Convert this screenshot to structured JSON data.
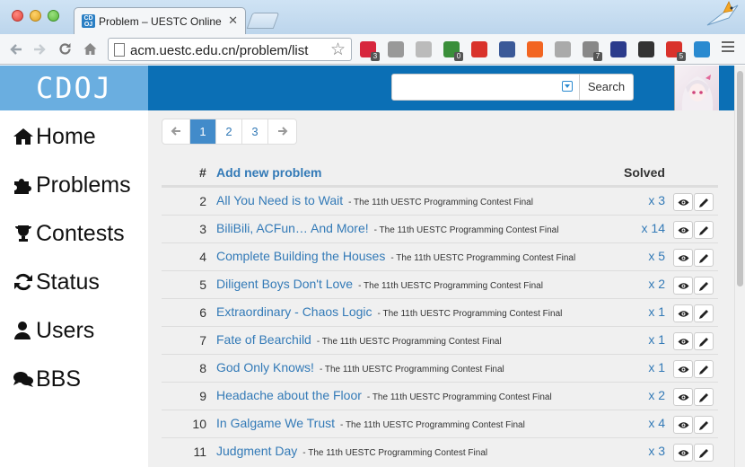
{
  "browser": {
    "tab_title": "Problem – UESTC Online Ju",
    "url": "acm.uestc.edu.cn/problem/list",
    "extensions": [
      {
        "name": "lastpass-icon",
        "color": "#d7263d",
        "badge": "3"
      },
      {
        "name": "pocket-icon",
        "color": "#999999",
        "badge": ""
      },
      {
        "name": "sync-icon",
        "color": "#bbbbbb",
        "badge": ""
      },
      {
        "name": "html-validator-icon",
        "color": "#3a8f3a",
        "badge": "0"
      },
      {
        "name": "adblock-icon",
        "color": "#d9322b",
        "badge": ""
      },
      {
        "name": "facebook-icon",
        "color": "#3b5998",
        "badge": ""
      },
      {
        "name": "rss-icon",
        "color": "#f26522",
        "badge": ""
      },
      {
        "name": "bell-icon",
        "color": "#aaaaaa",
        "badge": ""
      },
      {
        "name": "screen-capture-icon",
        "color": "#888888",
        "badge": "7"
      },
      {
        "name": "mountain-icon",
        "color": "#2b3b8c",
        "badge": ""
      },
      {
        "name": "color-picker-icon",
        "color": "#333333",
        "badge": ""
      },
      {
        "name": "puzzle-ext-icon",
        "color": "#d9322b",
        "badge": "5"
      },
      {
        "name": "camera-icon",
        "color": "#2a8ad0",
        "badge": ""
      }
    ]
  },
  "header": {
    "brand": "CDOJ",
    "search_placeholder": "",
    "search_button": "Search",
    "brand_color": "#6aaee0",
    "bar_color": "#0b6fb5"
  },
  "sidebar": {
    "items": [
      {
        "label": "Home",
        "icon": "home-icon"
      },
      {
        "label": "Problems",
        "icon": "puzzle-icon"
      },
      {
        "label": "Contests",
        "icon": "trophy-icon"
      },
      {
        "label": "Status",
        "icon": "refresh-icon"
      },
      {
        "label": "Users",
        "icon": "user-icon"
      },
      {
        "label": "BBS",
        "icon": "comments-icon"
      }
    ]
  },
  "pagination": {
    "prev": "←",
    "next": "→",
    "pages": [
      "1",
      "2",
      "3"
    ],
    "active": "1"
  },
  "table": {
    "headers": {
      "id": "#",
      "title": "Add new problem",
      "solved": "Solved"
    },
    "rows": [
      {
        "id": "2",
        "title": "All You Need is to Wait",
        "source": "- The 11th UESTC Programming Contest Final",
        "solved": "x 3"
      },
      {
        "id": "3",
        "title": "BiliBili, ACFun… And More!",
        "source": "- The 11th UESTC Programming Contest Final",
        "solved": "x 14"
      },
      {
        "id": "4",
        "title": "Complete Building the Houses",
        "source": "- The 11th UESTC Programming Contest Final",
        "solved": "x 5"
      },
      {
        "id": "5",
        "title": "Diligent Boys Don't Love",
        "source": "- The 11th UESTC Programming Contest Final",
        "solved": "x 2"
      },
      {
        "id": "6",
        "title": "Extraordinary - Chaos Logic",
        "source": "- The 11th UESTC Programming Contest Final",
        "solved": "x 1"
      },
      {
        "id": "7",
        "title": "Fate of Bearchild",
        "source": "- The 11th UESTC Programming Contest Final",
        "solved": "x 1"
      },
      {
        "id": "8",
        "title": "God Only Knows!",
        "source": "- The 11th UESTC Programming Contest Final",
        "solved": "x 1"
      },
      {
        "id": "9",
        "title": "Headache about the Floor",
        "source": "- The 11th UESTC Programming Contest Final",
        "solved": "x 2"
      },
      {
        "id": "10",
        "title": "In Galgame We Trust",
        "source": "- The 11th UESTC Programming Contest Final",
        "solved": "x 4"
      },
      {
        "id": "11",
        "title": "Judgment Day",
        "source": "- The 11th UESTC Programming Contest Final",
        "solved": "x 3"
      }
    ]
  }
}
